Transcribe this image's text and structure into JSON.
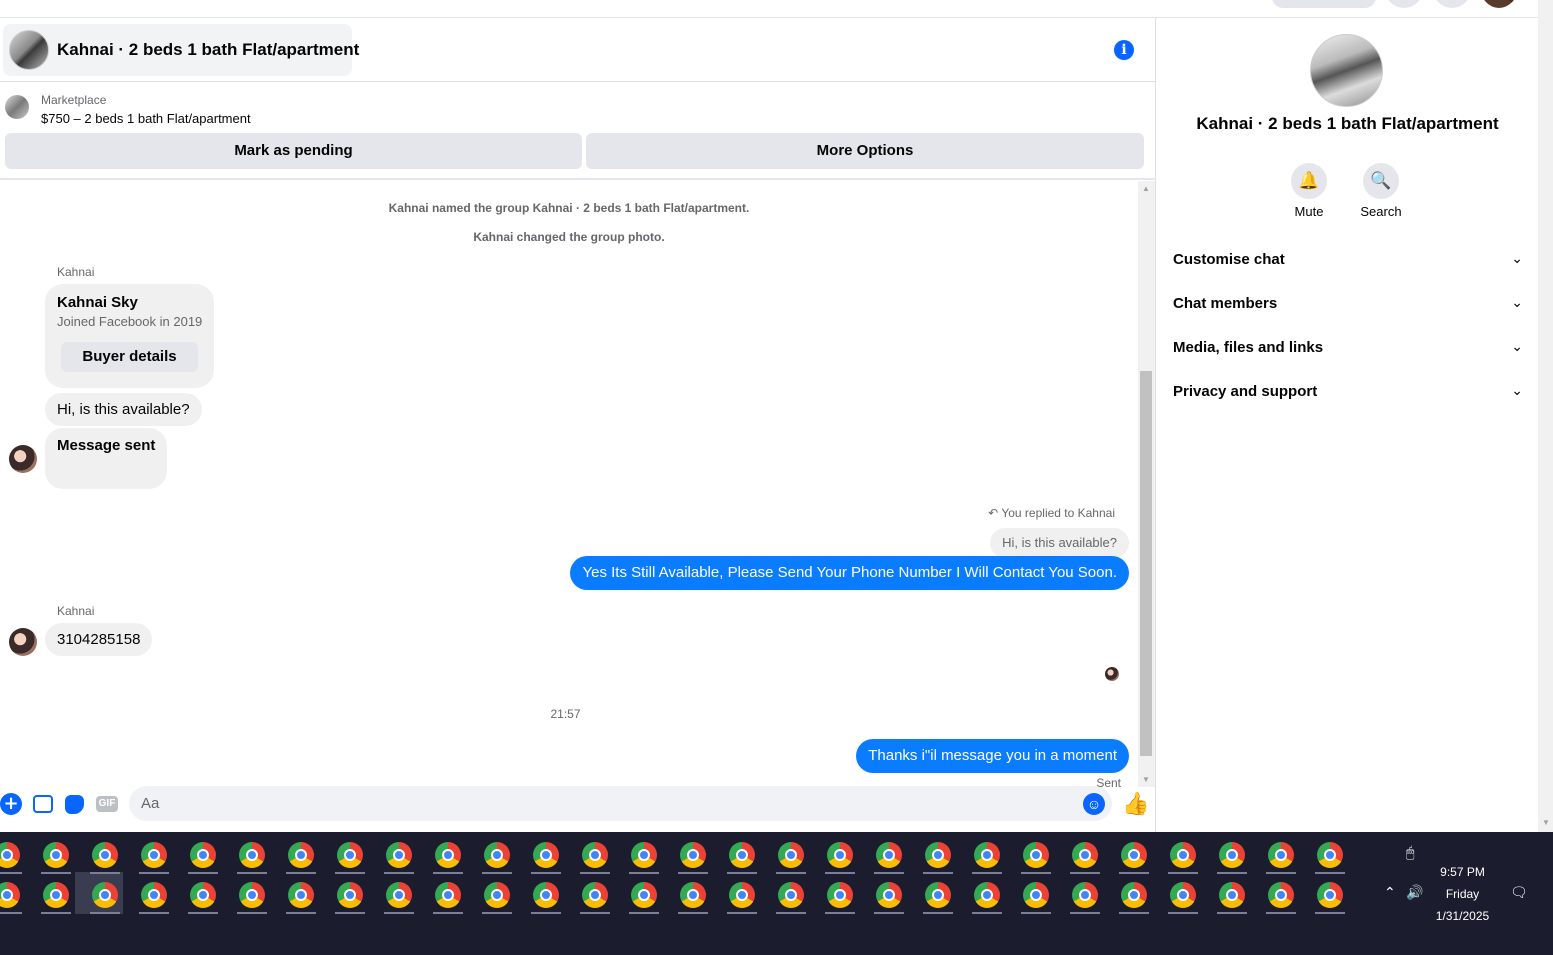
{
  "header": {
    "title": "Kahnai · 2 beds 1 bath Flat/apartment"
  },
  "listing": {
    "source_label": "Marketplace",
    "price_title": "$750 – 2 beds 1 bath Flat/apartment",
    "mark_pending_label": "Mark as pending",
    "more_options_label": "More Options"
  },
  "messages": {
    "system": [
      "Kahnai named the group Kahnai · 2 beds 1 bath Flat/apartment.",
      "Kahnai changed the group photo."
    ],
    "sender_name": "Kahnai",
    "buyer_card": {
      "name": "Kahnai Sky",
      "joined": "Joined Facebook in 2019",
      "button_label": "Buyer details"
    },
    "incoming_1": "Hi, is this available?",
    "incoming_2": "Message sent",
    "reply_note": "You replied to Kahnai",
    "reply_quote": "Hi, is this available?",
    "outgoing_1": "Yes Its Still Available, Please Send Your Phone Number I Will Contact You Soon.",
    "incoming_3": "3104285158",
    "timestamp": "21:57",
    "outgoing_2": "Thanks i\"il message you in a moment",
    "status": "Sent"
  },
  "composer": {
    "placeholder": "Aa",
    "gif_label": "GIF",
    "icons": [
      "plus-icon",
      "photo-icon",
      "sticker-icon",
      "gif-icon",
      "emoji-icon",
      "thumbs-up-icon"
    ]
  },
  "info_panel": {
    "title": "Kahnai · 2 beds 1 bath Flat/apartment",
    "mute_label": "Mute",
    "search_label": "Search",
    "sections": [
      "Customise chat",
      "Chat members",
      "Media, files and links",
      "Privacy and support"
    ]
  },
  "taskbar": {
    "time": "9:57 PM",
    "day": "Friday",
    "date": "1/31/2025",
    "app_icon": "chrome-icon"
  },
  "colors": {
    "accent": "#0866ff",
    "outgoing_bubble": "#0a7cff",
    "incoming_bubble": "#f0f0f0",
    "taskbar": "#1b1d2e"
  }
}
